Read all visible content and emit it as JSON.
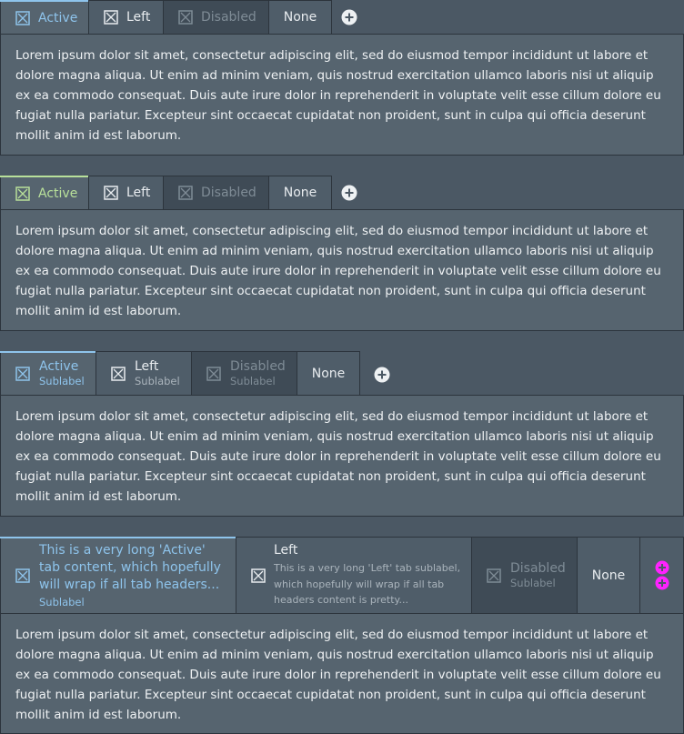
{
  "lorem": "Lorem ipsum dolor sit amet, consectetur adipiscing elit, sed do eiusmod tempor incididunt ut labore et dolore magna aliqua. Ut enim ad minim veniam, quis nostrud exercitation ullamco laboris nisi ut aliquip ex ea commodo consequat. Duis aute irure dolor in reprehenderit in voluptate velit esse cillum dolore eu fugiat nulla pariatur. Excepteur sint occaecat cupidatat non proident, sunt in culpa qui officia deserunt mollit anim id est laborum.",
  "colors": {
    "accent_blue": "#8ec4ec",
    "accent_green": "#b8e09a",
    "magenta_add": "#ff22ff"
  },
  "icons": {
    "tab_icon": "checkbox-cross-icon",
    "add_icon": "plus-circle-icon"
  },
  "group1": {
    "tabs": [
      {
        "label": "Active"
      },
      {
        "label": "Left"
      },
      {
        "label": "Disabled"
      },
      {
        "label": "None"
      }
    ]
  },
  "group2": {
    "tabs": [
      {
        "label": "Active"
      },
      {
        "label": "Left"
      },
      {
        "label": "Disabled"
      },
      {
        "label": "None"
      }
    ]
  },
  "group3": {
    "tabs": [
      {
        "label": "Active",
        "sublabel": "Sublabel"
      },
      {
        "label": "Left",
        "sublabel": "Sublabel"
      },
      {
        "label": "Disabled",
        "sublabel": "Sublabel"
      },
      {
        "label": "None"
      }
    ]
  },
  "group4": {
    "tabs": [
      {
        "label": "This is a very long 'Active' tab content, which hopefully will wrap if all tab headers...",
        "sublabel": "Sublabel"
      },
      {
        "label": "Left",
        "sublabel": "This is a very long 'Left' tab sublabel, which hopefully will wrap if all tab headers content is pretty..."
      },
      {
        "label": "Disabled",
        "sublabel": "Sublabel"
      },
      {
        "label": "None"
      }
    ]
  }
}
